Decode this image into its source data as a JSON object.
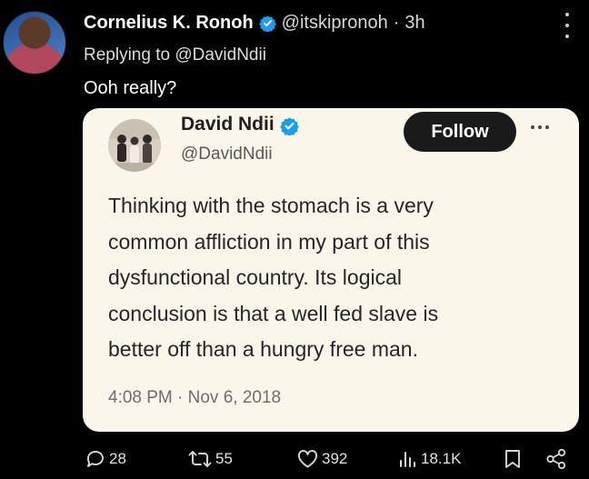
{
  "post": {
    "author": {
      "display_name": "Cornelius K. Ronoh",
      "handle": "@itskipronoh",
      "separator": "·",
      "time_ago": "3h",
      "verified": true
    },
    "replying_to": {
      "prefix": "Replying to",
      "mention": "@DavidNdii"
    },
    "text": "Ooh really?",
    "quoted_tweet": {
      "author_name": "David Ndii",
      "author_handle": "@DavidNdii",
      "verified": true,
      "follow_label": "Follow",
      "text_lines": [
        "Thinking with the stomach is a very",
        "common affliction in my part of this",
        "dysfunctional country.  Its logical",
        "conclusion is that a well fed slave is",
        "better off than a hungry free man."
      ],
      "timestamp": "4:08 PM · Nov 6, 2018"
    },
    "actions": {
      "replies": "28",
      "reposts": "55",
      "likes": "392",
      "views": "18.1K"
    }
  },
  "icons": {
    "verified": "verified-badge-icon",
    "more_vertical": "more-vertical-icon",
    "more_horizontal": "more-horizontal-icon",
    "reply": "reply-icon",
    "repost": "repost-icon",
    "like": "heart-icon",
    "views": "views-icon",
    "bookmark": "bookmark-icon",
    "share": "share-icon"
  },
  "colors": {
    "background": "#000000",
    "verified_blue": "#1d9bf0",
    "card_background": "#fbf6ea",
    "follow_button": "#1a1a1a"
  }
}
